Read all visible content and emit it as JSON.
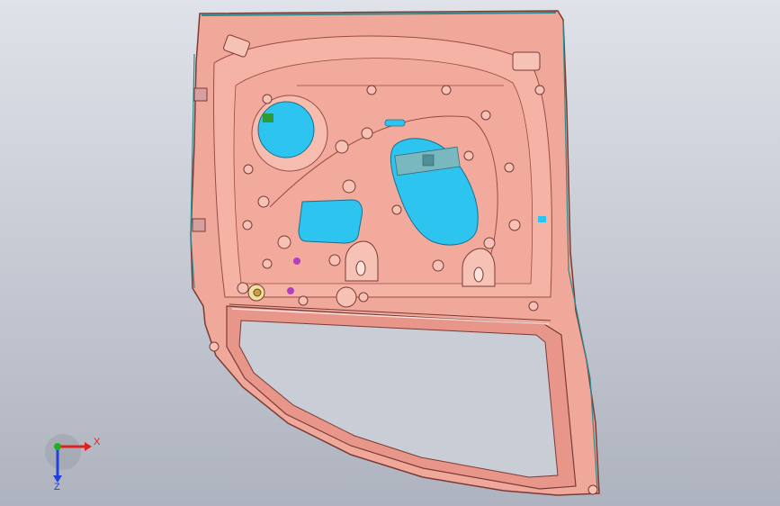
{
  "viewport": {
    "background_top": "#dfe2e8",
    "background_bottom": "#aeb3bf",
    "part_fill": "#f0a89a",
    "part_edge": "#9a4b44",
    "hole_fill": "#2ec4f0"
  },
  "triad": {
    "x_label": "X",
    "z_label": "Z",
    "x_color": "#e02020",
    "y_color": "#20b020",
    "z_color": "#2040e0"
  }
}
